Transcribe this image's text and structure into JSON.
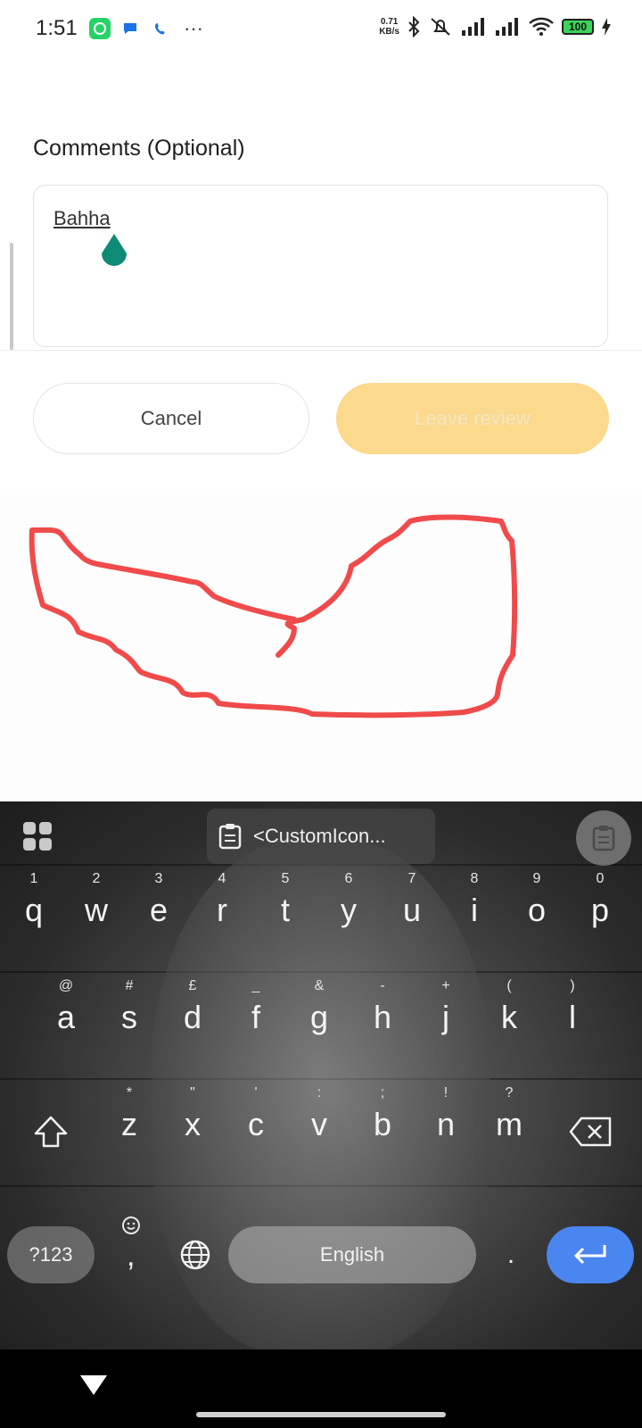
{
  "status_bar": {
    "time": "1:51",
    "more": "···",
    "net_speed_value": "0.71",
    "net_speed_unit": "KB/s",
    "battery": "100"
  },
  "form": {
    "comments_label": "Comments (Optional)",
    "comment_value": "Bahha",
    "cancel_label": "Cancel",
    "leave_review_label": "Leave review"
  },
  "keyboard": {
    "clipboard_suggestion": "<CustomIcon...",
    "rows": [
      [
        {
          "key": "q",
          "hint": "1"
        },
        {
          "key": "w",
          "hint": "2"
        },
        {
          "key": "e",
          "hint": "3"
        },
        {
          "key": "r",
          "hint": "4"
        },
        {
          "key": "t",
          "hint": "5"
        },
        {
          "key": "y",
          "hint": "6"
        },
        {
          "key": "u",
          "hint": "7"
        },
        {
          "key": "i",
          "hint": "8"
        },
        {
          "key": "o",
          "hint": "9"
        },
        {
          "key": "p",
          "hint": "0"
        }
      ],
      [
        {
          "key": "a",
          "hint": "@"
        },
        {
          "key": "s",
          "hint": "#"
        },
        {
          "key": "d",
          "hint": "£"
        },
        {
          "key": "f",
          "hint": "_"
        },
        {
          "key": "g",
          "hint": "&"
        },
        {
          "key": "h",
          "hint": "-"
        },
        {
          "key": "j",
          "hint": "+"
        },
        {
          "key": "k",
          "hint": "("
        },
        {
          "key": "l",
          "hint": ")"
        }
      ],
      [
        {
          "key": "z",
          "hint": "*"
        },
        {
          "key": "x",
          "hint": "\""
        },
        {
          "key": "c",
          "hint": "'"
        },
        {
          "key": "v",
          "hint": ":"
        },
        {
          "key": "b",
          "hint": ";"
        },
        {
          "key": "n",
          "hint": "!"
        },
        {
          "key": "m",
          "hint": "?"
        }
      ]
    ],
    "symbols_label": "?123",
    "comma_label": ",",
    "space_label": "English",
    "period_label": "."
  },
  "colors": {
    "accent_button": "#fbd98d",
    "enter_key": "#4a86f0",
    "cursor_handle": "#0f8a74",
    "scribble": "#f04a4a"
  }
}
